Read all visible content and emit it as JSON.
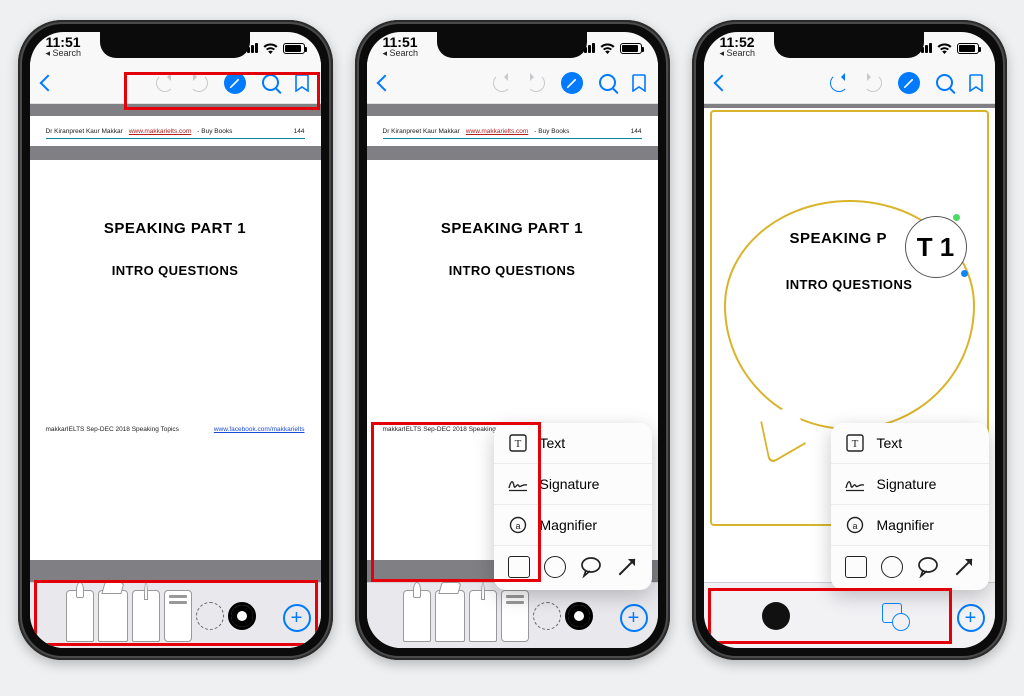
{
  "status": {
    "time_a": "11:51",
    "time_c": "11:52",
    "back_label": "Search"
  },
  "page": {
    "author": "Dr Kiranpreet Kaur Makkar",
    "site": "www.makkarielts.com",
    "buy": "- Buy Books",
    "num": "144",
    "heading1": "SPEAKING PART 1",
    "heading2": "INTRO QUESTIONS",
    "footer_left": "makkarIELTS Sep-DEC 2018 Speaking Topics",
    "footer_right": "www.facebook.com/makkarielts"
  },
  "magnifier_text": "T  1",
  "popover": {
    "text": "Text",
    "signature": "Signature",
    "magnifier": "Magnifier"
  }
}
